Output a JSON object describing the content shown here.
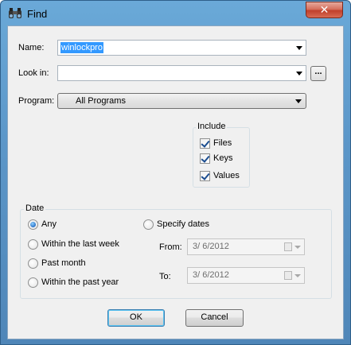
{
  "window": {
    "title": "Find",
    "close_label": "✕"
  },
  "name": {
    "label": "Name:",
    "value": "winlockpro"
  },
  "look_in": {
    "label": "Look in:",
    "value": "",
    "browse_label": "..."
  },
  "program": {
    "label": "Program:",
    "value": "All Programs"
  },
  "include": {
    "title": "Include",
    "items": [
      {
        "label": "Files",
        "checked": true
      },
      {
        "label": "Keys",
        "checked": true
      },
      {
        "label": "Values",
        "checked": true
      }
    ]
  },
  "date": {
    "title": "Date",
    "options": [
      {
        "label": "Any",
        "selected": true
      },
      {
        "label": "Within the last week",
        "selected": false
      },
      {
        "label": "Past month",
        "selected": false
      },
      {
        "label": "Within the past year",
        "selected": false
      },
      {
        "label": "Specify dates",
        "selected": false
      }
    ],
    "from_label": "From:",
    "from_value": "3/ 6/2012",
    "to_label": "To:",
    "to_value": "3/ 6/2012"
  },
  "buttons": {
    "ok": "OK",
    "cancel": "Cancel"
  }
}
